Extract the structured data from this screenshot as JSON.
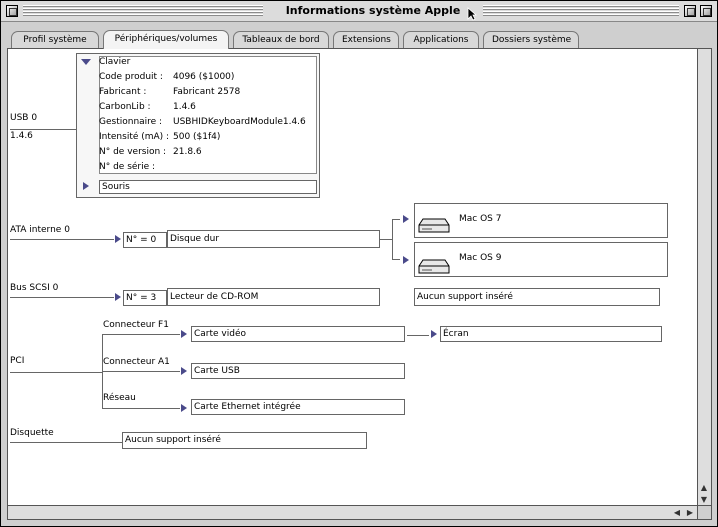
{
  "window": {
    "title": "Informations système Apple"
  },
  "tabs": [
    {
      "label": "Profil système",
      "active": false
    },
    {
      "label": "Périphériques/volumes",
      "active": true
    },
    {
      "label": "Tableaux de bord",
      "active": false
    },
    {
      "label": "Extensions",
      "active": false
    },
    {
      "label": "Applications",
      "active": false
    },
    {
      "label": "Dossiers système",
      "active": false
    }
  ],
  "usb": {
    "bus_label": "USB 0",
    "bus_version": "1.4.6",
    "keyboard": {
      "name": "Clavier",
      "fields": [
        {
          "key": "Code produit :",
          "value": "4096 ($1000)"
        },
        {
          "key": "Fabricant :",
          "value": "Fabricant 2578"
        },
        {
          "key": "CarbonLib :",
          "value": "1.4.6"
        },
        {
          "key": "Gestionnaire :",
          "value": "USBHIDKeyboardModule1.4.6"
        },
        {
          "key": "Intensité (mA) :",
          "value": "500 ($1f4)"
        },
        {
          "key": "N° de version :",
          "value": "21.8.6"
        },
        {
          "key": "N° de série :",
          "value": ""
        }
      ]
    },
    "mouse": {
      "name": "Souris"
    }
  },
  "ata": {
    "bus_label": "ATA interne 0",
    "id": "N° = 0",
    "device": "Disque dur",
    "volumes": [
      "Mac OS 7",
      "Mac OS 9"
    ]
  },
  "scsi": {
    "bus_label": "Bus SCSI 0",
    "id": "N° = 3",
    "device": "Lecteur de CD-ROM",
    "status": "Aucun support inséré"
  },
  "pci": {
    "bus_label": "PCI",
    "slots": [
      {
        "connector": "Connecteur F1",
        "card": "Carte vidéo",
        "child": "Écran"
      },
      {
        "connector": "Connecteur A1",
        "card": "Carte USB"
      },
      {
        "connector": "Réseau",
        "card": "Carte Ethernet intégrée"
      }
    ]
  },
  "floppy": {
    "bus_label": "Disquette",
    "status": "Aucun support inséré"
  },
  "colors": {
    "disclosure": "#4a4a8a",
    "window_bg": "#cfcfcf"
  },
  "icons": [
    "close-box-icon",
    "zoom-box-icon",
    "collapse-box-icon",
    "disclosure-triangle-icon",
    "hard-disk-icon",
    "scroll-arrow-icon",
    "grow-box-icon",
    "cursor-icon"
  ]
}
